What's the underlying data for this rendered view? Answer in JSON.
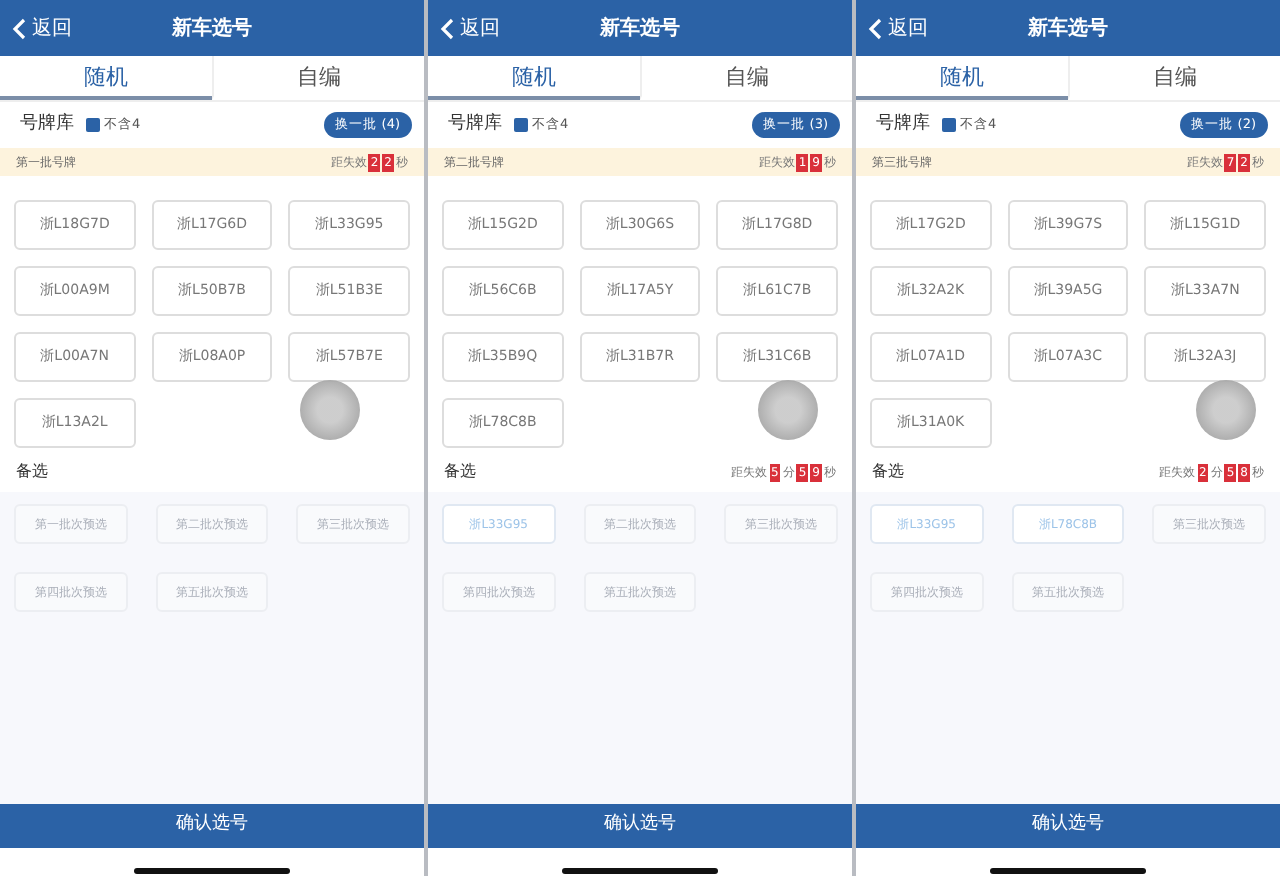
{
  "screens": [
    {
      "header": {
        "back": "返回",
        "title": "新车选号"
      },
      "tabs": [
        {
          "label": "随机",
          "selected": true
        },
        {
          "label": "自编",
          "selected": false
        }
      ],
      "pool": {
        "label": "号牌库",
        "option": {
          "label": "不含4",
          "checked": true
        },
        "refresh": "换一批 (4)"
      },
      "batch": {
        "label": "第一批号牌",
        "prefix": "距失效",
        "digits": [
          "2",
          "2"
        ],
        "unit": "秒"
      },
      "plates": [
        "浙L18G7D",
        "浙L17G6D",
        "浙L33G95",
        "浙L00A9M",
        "浙L50B7B",
        "浙L51B3E",
        "浙L00A7N",
        "浙L08A0P",
        "浙L57B7E",
        "浙L13A2L"
      ],
      "backup": {
        "label": "备选",
        "slots": [
          {
            "kind": "empty",
            "text": "第一批次预选"
          },
          {
            "kind": "empty",
            "text": "第二批次预选"
          },
          {
            "kind": "empty",
            "text": "第三批次预选"
          },
          {
            "kind": "empty",
            "text": "第四批次预选"
          },
          {
            "kind": "empty",
            "text": "第五批次预选"
          }
        ]
      },
      "confirm": "确认选号"
    },
    {
      "header": {
        "back": "返回",
        "title": "新车选号"
      },
      "tabs": [
        {
          "label": "随机",
          "selected": true
        },
        {
          "label": "自编",
          "selected": false
        }
      ],
      "pool": {
        "label": "号牌库",
        "option": {
          "label": "不含4",
          "checked": true
        },
        "refresh": "换一批 (3)"
      },
      "batch": {
        "label": "第二批号牌",
        "prefix": "距失效",
        "digits": [
          "1",
          "9"
        ],
        "unit": "秒"
      },
      "plates": [
        "浙L15G2D",
        "浙L30G6S",
        "浙L17G8D",
        "浙L56C6B",
        "浙L17A5Y",
        "浙L61C7B",
        "浙L35B9Q",
        "浙L31B7R",
        "浙L31C6B",
        "浙L78C8B"
      ],
      "backup": {
        "label": "备选",
        "countdown": {
          "prefix": "距失效",
          "minutes": "5",
          "minute_unit": "分",
          "seconds": [
            "5",
            "9"
          ],
          "second_unit": "秒"
        },
        "slots": [
          {
            "kind": "filled",
            "text": "浙L33G95"
          },
          {
            "kind": "empty",
            "text": "第二批次预选"
          },
          {
            "kind": "empty",
            "text": "第三批次预选"
          },
          {
            "kind": "empty",
            "text": "第四批次预选"
          },
          {
            "kind": "empty",
            "text": "第五批次预选"
          }
        ]
      },
      "confirm": "确认选号"
    },
    {
      "header": {
        "back": "返回",
        "title": "新车选号"
      },
      "tabs": [
        {
          "label": "随机",
          "selected": true
        },
        {
          "label": "自编",
          "selected": false
        }
      ],
      "pool": {
        "label": "号牌库",
        "option": {
          "label": "不含4",
          "checked": true
        },
        "refresh": "换一批 (2)"
      },
      "batch": {
        "label": "第三批号牌",
        "prefix": "距失效",
        "digits": [
          "7",
          "2"
        ],
        "unit": "秒"
      },
      "plates": [
        "浙L17G2D",
        "浙L39G7S",
        "浙L15G1D",
        "浙L32A2K",
        "浙L39A5G",
        "浙L33A7N",
        "浙L07A1D",
        "浙L07A3C",
        "浙L32A3J",
        "浙L31A0K"
      ],
      "backup": {
        "label": "备选",
        "countdown": {
          "prefix": "距失效",
          "minutes": "2",
          "minute_unit": "分",
          "seconds": [
            "5",
            "8"
          ],
          "second_unit": "秒"
        },
        "slots": [
          {
            "kind": "filled",
            "text": "浙L33G95"
          },
          {
            "kind": "filled",
            "text": "浙L78C8B"
          },
          {
            "kind": "empty",
            "text": "第三批次预选"
          },
          {
            "kind": "empty",
            "text": "第四批次预选"
          },
          {
            "kind": "empty",
            "text": "第五批次预选"
          }
        ]
      },
      "confirm": "确认选号"
    }
  ]
}
